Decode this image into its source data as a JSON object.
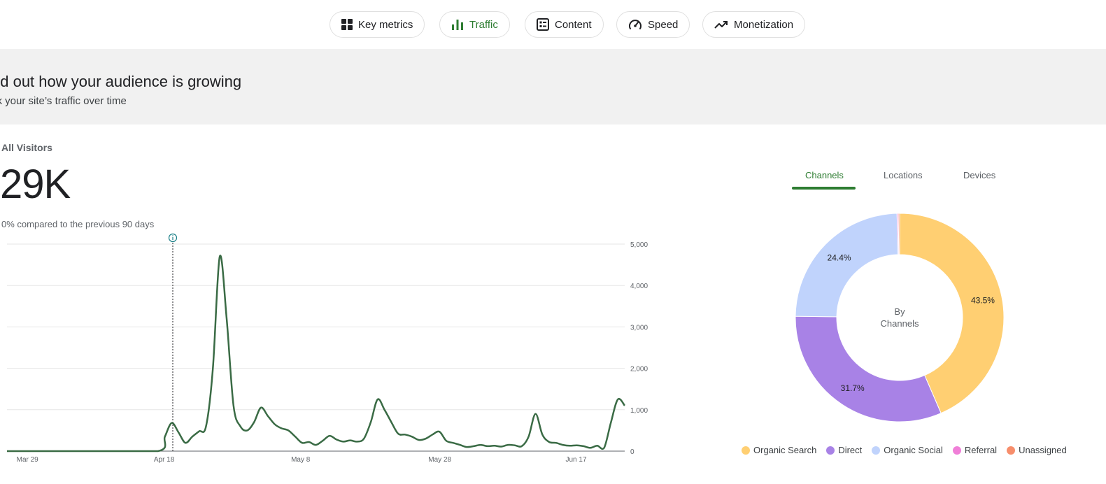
{
  "nav": {
    "tabs": [
      {
        "label": "Key metrics",
        "icon": "grid-icon"
      },
      {
        "label": "Traffic",
        "icon": "bar-chart-icon",
        "active": true
      },
      {
        "label": "Content",
        "icon": "content-list-icon"
      },
      {
        "label": "Speed",
        "icon": "speedometer-icon"
      },
      {
        "label": "Monetization",
        "icon": "trending-up-icon"
      }
    ]
  },
  "banner": {
    "title": "nd out how your audience is growing",
    "subtitle": "ck your site’s traffic over time"
  },
  "metric": {
    "label": "All Visitors",
    "value": "29K",
    "compare": "0% compared to the previous 90 days"
  },
  "chart_data": [
    {
      "type": "line",
      "title": "",
      "xlabel": "",
      "ylabel": "",
      "x_tick_labels": [
        "Mar 29",
        "Apr 18",
        "May 8",
        "May 28",
        "Jun 17"
      ],
      "y_tick_labels": [
        "5,000",
        "4,000",
        "3,000",
        "2,000",
        "1,000",
        "0"
      ],
      "ylim": [
        0,
        5000
      ],
      "grid": true,
      "annotation": "info-icon marker at Apr 20",
      "series": [
        {
          "color": "#3a6b45",
          "points": [
            [
              "Mar 27",
              0
            ],
            [
              "Apr 8",
              0
            ],
            [
              "Apr 18",
              0
            ],
            [
              "Apr 19",
              350
            ],
            [
              "Apr 20",
              680
            ],
            [
              "Apr 21",
              450
            ],
            [
              "Apr 22",
              200
            ],
            [
              "Apr 23",
              350
            ],
            [
              "Apr 24",
              480
            ],
            [
              "Apr 25",
              600
            ],
            [
              "Apr 26",
              2000
            ],
            [
              "Apr 27",
              4700
            ],
            [
              "Apr 28",
              3200
            ],
            [
              "Apr 29",
              1100
            ],
            [
              "Apr 30",
              600
            ],
            [
              "May 1",
              500
            ],
            [
              "May 2",
              700
            ],
            [
              "May 3",
              1050
            ],
            [
              "May 4",
              850
            ],
            [
              "May 5",
              650
            ],
            [
              "May 6",
              550
            ],
            [
              "May 7",
              500
            ],
            [
              "May 8",
              350
            ],
            [
              "May 9",
              200
            ],
            [
              "May 10",
              220
            ],
            [
              "May 11",
              150
            ],
            [
              "May 12",
              250
            ],
            [
              "May 13",
              370
            ],
            [
              "May 14",
              280
            ],
            [
              "May 15",
              230
            ],
            [
              "May 16",
              260
            ],
            [
              "May 17",
              230
            ],
            [
              "May 18",
              300
            ],
            [
              "May 19",
              700
            ],
            [
              "May 20",
              1250
            ],
            [
              "May 21",
              1000
            ],
            [
              "May 22",
              700
            ],
            [
              "May 23",
              420
            ],
            [
              "May 24",
              400
            ],
            [
              "May 25",
              350
            ],
            [
              "May 26",
              270
            ],
            [
              "May 27",
              300
            ],
            [
              "May 28",
              400
            ],
            [
              "May 29",
              470
            ],
            [
              "May 30",
              250
            ],
            [
              "May 31",
              200
            ],
            [
              "Jun 1",
              150
            ],
            [
              "Jun 2",
              100
            ],
            [
              "Jun 3",
              120
            ],
            [
              "Jun 4",
              150
            ],
            [
              "Jun 5",
              120
            ],
            [
              "Jun 6",
              130
            ],
            [
              "Jun 7",
              110
            ],
            [
              "Jun 8",
              150
            ],
            [
              "Jun 9",
              140
            ],
            [
              "Jun 10",
              120
            ],
            [
              "Jun 11",
              350
            ],
            [
              "Jun 12",
              900
            ],
            [
              "Jun 13",
              400
            ],
            [
              "Jun 14",
              220
            ],
            [
              "Jun 15",
              200
            ],
            [
              "Jun 16",
              150
            ],
            [
              "Jun 17",
              130
            ],
            [
              "Jun 18",
              140
            ],
            [
              "Jun 19",
              120
            ],
            [
              "Jun 20",
              80
            ],
            [
              "Jun 21",
              130
            ],
            [
              "Jun 22",
              80
            ],
            [
              "Jun 23",
              700
            ],
            [
              "Jun 24",
              1250
            ],
            [
              "Jun 25",
              1100
            ]
          ]
        }
      ]
    },
    {
      "type": "pie",
      "center_label": [
        "By",
        "Channels"
      ],
      "slices": [
        {
          "name": "Organic Search",
          "value": 43.5,
          "label": "43.5%",
          "color": "#ffcf72"
        },
        {
          "name": "Direct",
          "value": 31.7,
          "label": "31.7%",
          "color": "#a882e6"
        },
        {
          "name": "Organic Social",
          "value": 24.4,
          "label": "24.4%",
          "color": "#c0d3fc"
        },
        {
          "name": "Referral",
          "value": 0.2,
          "label": "",
          "color": "#f07fd8"
        },
        {
          "name": "Unassigned",
          "value": 0.2,
          "label": "",
          "color": "#f78e6c"
        }
      ]
    }
  ],
  "right_tabs": {
    "tabs": [
      "Channels",
      "Locations",
      "Devices"
    ],
    "active": "Channels"
  },
  "legend": [
    {
      "label": "Organic Search",
      "color": "#ffcf72"
    },
    {
      "label": "Direct",
      "color": "#a882e6"
    },
    {
      "label": "Organic Social",
      "color": "#c0d3fc"
    },
    {
      "label": "Referral",
      "color": "#f07fd8"
    },
    {
      "label": "Unassigned",
      "color": "#f78e6c"
    }
  ],
  "colors": {
    "accent": "#2e7d32",
    "line": "#3a6b45",
    "annotation": "#1a7f87"
  }
}
